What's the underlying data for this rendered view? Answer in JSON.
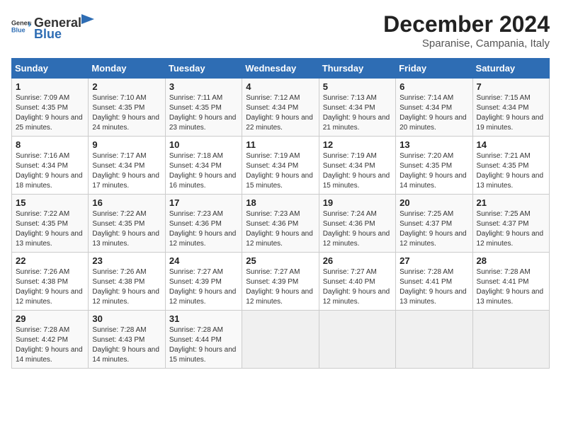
{
  "logo": {
    "general": "General",
    "blue": "Blue"
  },
  "header": {
    "title": "December 2024",
    "subtitle": "Sparanise, Campania, Italy"
  },
  "weekdays": [
    "Sunday",
    "Monday",
    "Tuesday",
    "Wednesday",
    "Thursday",
    "Friday",
    "Saturday"
  ],
  "weeks": [
    [
      {
        "day": "1",
        "sunrise": "7:09 AM",
        "sunset": "4:35 PM",
        "daylight": "9 hours and 25 minutes."
      },
      {
        "day": "2",
        "sunrise": "7:10 AM",
        "sunset": "4:35 PM",
        "daylight": "9 hours and 24 minutes."
      },
      {
        "day": "3",
        "sunrise": "7:11 AM",
        "sunset": "4:35 PM",
        "daylight": "9 hours and 23 minutes."
      },
      {
        "day": "4",
        "sunrise": "7:12 AM",
        "sunset": "4:34 PM",
        "daylight": "9 hours and 22 minutes."
      },
      {
        "day": "5",
        "sunrise": "7:13 AM",
        "sunset": "4:34 PM",
        "daylight": "9 hours and 21 minutes."
      },
      {
        "day": "6",
        "sunrise": "7:14 AM",
        "sunset": "4:34 PM",
        "daylight": "9 hours and 20 minutes."
      },
      {
        "day": "7",
        "sunrise": "7:15 AM",
        "sunset": "4:34 PM",
        "daylight": "9 hours and 19 minutes."
      }
    ],
    [
      {
        "day": "8",
        "sunrise": "7:16 AM",
        "sunset": "4:34 PM",
        "daylight": "9 hours and 18 minutes."
      },
      {
        "day": "9",
        "sunrise": "7:17 AM",
        "sunset": "4:34 PM",
        "daylight": "9 hours and 17 minutes."
      },
      {
        "day": "10",
        "sunrise": "7:18 AM",
        "sunset": "4:34 PM",
        "daylight": "9 hours and 16 minutes."
      },
      {
        "day": "11",
        "sunrise": "7:19 AM",
        "sunset": "4:34 PM",
        "daylight": "9 hours and 15 minutes."
      },
      {
        "day": "12",
        "sunrise": "7:19 AM",
        "sunset": "4:34 PM",
        "daylight": "9 hours and 15 minutes."
      },
      {
        "day": "13",
        "sunrise": "7:20 AM",
        "sunset": "4:35 PM",
        "daylight": "9 hours and 14 minutes."
      },
      {
        "day": "14",
        "sunrise": "7:21 AM",
        "sunset": "4:35 PM",
        "daylight": "9 hours and 13 minutes."
      }
    ],
    [
      {
        "day": "15",
        "sunrise": "7:22 AM",
        "sunset": "4:35 PM",
        "daylight": "9 hours and 13 minutes."
      },
      {
        "day": "16",
        "sunrise": "7:22 AM",
        "sunset": "4:35 PM",
        "daylight": "9 hours and 13 minutes."
      },
      {
        "day": "17",
        "sunrise": "7:23 AM",
        "sunset": "4:36 PM",
        "daylight": "9 hours and 12 minutes."
      },
      {
        "day": "18",
        "sunrise": "7:23 AM",
        "sunset": "4:36 PM",
        "daylight": "9 hours and 12 minutes."
      },
      {
        "day": "19",
        "sunrise": "7:24 AM",
        "sunset": "4:36 PM",
        "daylight": "9 hours and 12 minutes."
      },
      {
        "day": "20",
        "sunrise": "7:25 AM",
        "sunset": "4:37 PM",
        "daylight": "9 hours and 12 minutes."
      },
      {
        "day": "21",
        "sunrise": "7:25 AM",
        "sunset": "4:37 PM",
        "daylight": "9 hours and 12 minutes."
      }
    ],
    [
      {
        "day": "22",
        "sunrise": "7:26 AM",
        "sunset": "4:38 PM",
        "daylight": "9 hours and 12 minutes."
      },
      {
        "day": "23",
        "sunrise": "7:26 AM",
        "sunset": "4:38 PM",
        "daylight": "9 hours and 12 minutes."
      },
      {
        "day": "24",
        "sunrise": "7:27 AM",
        "sunset": "4:39 PM",
        "daylight": "9 hours and 12 minutes."
      },
      {
        "day": "25",
        "sunrise": "7:27 AM",
        "sunset": "4:39 PM",
        "daylight": "9 hours and 12 minutes."
      },
      {
        "day": "26",
        "sunrise": "7:27 AM",
        "sunset": "4:40 PM",
        "daylight": "9 hours and 12 minutes."
      },
      {
        "day": "27",
        "sunrise": "7:28 AM",
        "sunset": "4:41 PM",
        "daylight": "9 hours and 13 minutes."
      },
      {
        "day": "28",
        "sunrise": "7:28 AM",
        "sunset": "4:41 PM",
        "daylight": "9 hours and 13 minutes."
      }
    ],
    [
      {
        "day": "29",
        "sunrise": "7:28 AM",
        "sunset": "4:42 PM",
        "daylight": "9 hours and 14 minutes."
      },
      {
        "day": "30",
        "sunrise": "7:28 AM",
        "sunset": "4:43 PM",
        "daylight": "9 hours and 14 minutes."
      },
      {
        "day": "31",
        "sunrise": "7:28 AM",
        "sunset": "4:44 PM",
        "daylight": "9 hours and 15 minutes."
      },
      null,
      null,
      null,
      null
    ]
  ],
  "labels": {
    "sunrise": "Sunrise:",
    "sunset": "Sunset:",
    "daylight": "Daylight:"
  }
}
